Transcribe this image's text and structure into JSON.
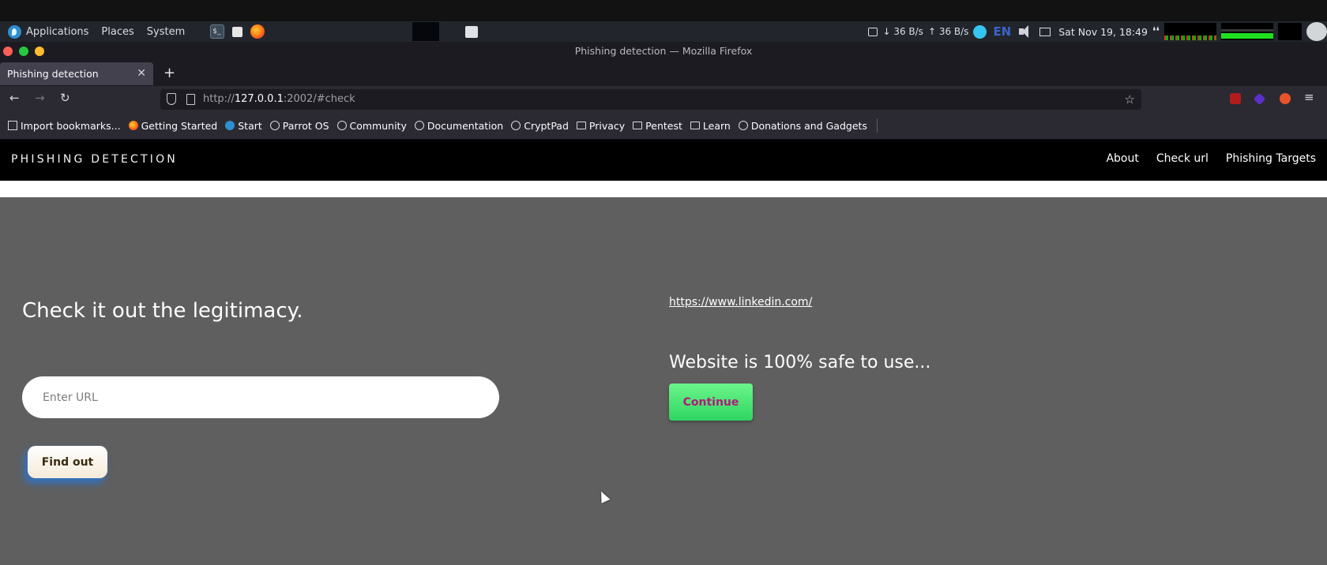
{
  "panel": {
    "menus": [
      "Applications",
      "Places",
      "System"
    ],
    "tray": {
      "net_down": "36 B/s",
      "net_up": "36 B/s",
      "language": "EN",
      "datetime": "Sat Nov 19, 18:49"
    }
  },
  "window": {
    "title": "Phishing detection — Mozilla Firefox"
  },
  "browser": {
    "tab_title": "Phishing detection",
    "url_prefix": "http://",
    "url_host": "127.0.0.1",
    "url_rest": ":2002/#check",
    "bookmarks": [
      {
        "icon": "import-icon",
        "label": "Import bookmarks..."
      },
      {
        "icon": "firefox-icon",
        "label": "Getting Started"
      },
      {
        "icon": "parrot-icon",
        "label": "Start"
      },
      {
        "icon": "globe-icon",
        "label": "Parrot OS"
      },
      {
        "icon": "globe-icon",
        "label": "Community"
      },
      {
        "icon": "globe-icon",
        "label": "Documentation"
      },
      {
        "icon": "globe-icon",
        "label": "CryptPad"
      },
      {
        "icon": "folder-icon",
        "label": "Privacy"
      },
      {
        "icon": "folder-icon",
        "label": "Pentest"
      },
      {
        "icon": "folder-icon",
        "label": "Learn"
      },
      {
        "icon": "globe-icon",
        "label": "Donations and Gadgets"
      }
    ]
  },
  "site": {
    "brand": "PHISHING DETECTION",
    "nav": [
      "About",
      "Check url",
      "Phishing Targets"
    ],
    "check": {
      "heading": "Check it out the legitimacy.",
      "input_placeholder": "Enter URL",
      "button_label": "Find out"
    },
    "result": {
      "checked_url": "https://www.linkedin.com/",
      "verdict": "Website is 100% safe to use...",
      "continue_label": "Continue"
    }
  },
  "colors": {
    "page_bg": "#5f5f5f",
    "navbar_bg": "#000000",
    "continue_bg": "#3fe36c",
    "continue_text": "#b3197a",
    "find_glow": "#2678dc"
  }
}
